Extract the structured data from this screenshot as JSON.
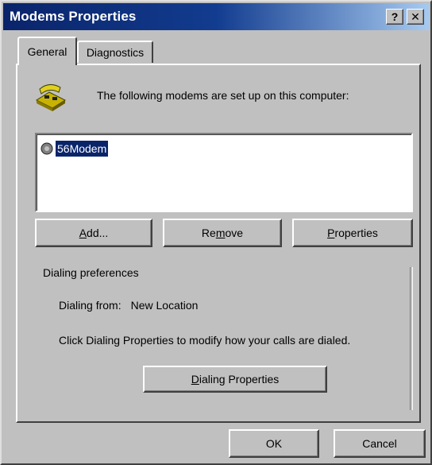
{
  "window": {
    "title": "Modems Properties",
    "help_glyph": "?",
    "close_glyph": "✕"
  },
  "tabs": [
    {
      "label": "General",
      "active": true
    },
    {
      "label": "Diagnostics",
      "active": false
    }
  ],
  "general": {
    "icon": "modem-icon",
    "intro": "The following modems are set up on this computer:",
    "modems": [
      {
        "label": "56Modem",
        "icon": "modem-small-icon",
        "selected": true
      }
    ],
    "buttons": {
      "add": {
        "pre": "",
        "accel": "A",
        "post": "dd..."
      },
      "remove": {
        "pre": "Re",
        "accel": "m",
        "post": "ove"
      },
      "properties": {
        "pre": "",
        "accel": "P",
        "post": "roperties"
      }
    },
    "dialing": {
      "group_title": "Dialing preferences",
      "from_label": "Dialing from:",
      "from_value": "New Location",
      "instructions": "Click Dialing Properties to modify how your calls are dialed.",
      "button": {
        "pre": "",
        "accel": "D",
        "post": "ialing Properties"
      }
    }
  },
  "footer": {
    "ok": "OK",
    "cancel": "Cancel"
  },
  "colors": {
    "titlebar_start": "#0a246a",
    "titlebar_end": "#a6caf0",
    "face": "#c0c0c0",
    "selection": "#0a246a"
  }
}
